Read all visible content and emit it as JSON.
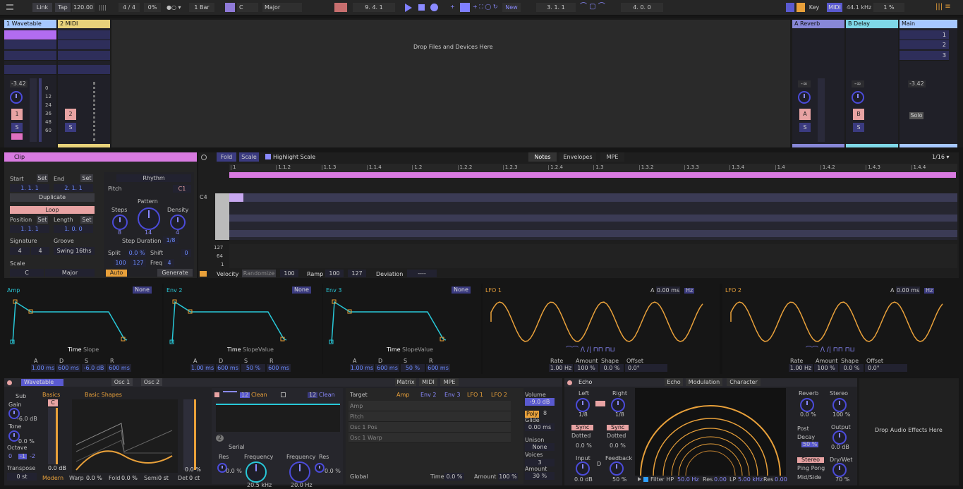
{
  "top": {
    "link": "Link",
    "tap": "Tap",
    "bpm": "120.00",
    "sig": "4 / 4",
    "swing": "0%",
    "quant": "1 Bar",
    "key": "C",
    "scale": "Major",
    "pos": "9.   4.   1",
    "new": "New",
    "loop_start": "3.   1.   1",
    "loop_len": "4.   0.   0",
    "key_btn": "Key",
    "midi_btn": "MIDI",
    "sr": "44.1 kHz",
    "cpu": "1 %"
  },
  "session": {
    "tracks": [
      {
        "name": "1 Wavetable",
        "color": "#a6c8ff",
        "vol": "-3.42",
        "num": "1",
        "solo": "S"
      },
      {
        "name": "2 MIDI",
        "color": "#e8d27a",
        "num": "2",
        "solo": "S"
      }
    ],
    "drop_text": "Drop Files and Devices Here",
    "returns": [
      {
        "name": "A Reverb",
        "vol": "-∞",
        "num": "A",
        "solo": "S"
      },
      {
        "name": "B Delay",
        "vol": "-∞",
        "num": "B",
        "solo": "S"
      }
    ],
    "main": {
      "name": "Main",
      "vol": "-3.42",
      "solo": "Solo",
      "scenes": [
        "1",
        "2",
        "3"
      ]
    },
    "db_ticks": [
      "0",
      "12",
      "24",
      "36",
      "48",
      "60"
    ]
  },
  "clip": {
    "title": "Clip",
    "start": "Start",
    "end": "End",
    "set": "Set",
    "start_val": "1.   1.   1",
    "end_val": "2.   1.   1",
    "duplicate": "Duplicate",
    "loop": "Loop",
    "position": "Position",
    "length": "Length",
    "pos_val": "1.   1.   1",
    "len_val": "1.   0.   0",
    "signature": "Signature",
    "groove": "Groove",
    "sig_num": "4",
    "sig_den": "4",
    "groove_val": "Swing 16ths",
    "scale": "Scale",
    "scale_key": "C",
    "scale_mode": "Major"
  },
  "rhythm": {
    "title": "Rhythm",
    "pitch": "Pitch",
    "pitch_val": "C1",
    "steps": "Steps",
    "pattern": "Pattern",
    "density": "Density",
    "steps_val": "8",
    "pattern_val": "14",
    "density_val": "4",
    "step_dur": "Step Duration",
    "step_dur_val": "1/8",
    "split": "Split",
    "split_val": "0.0 %",
    "shift": "Shift",
    "shift_val": "0",
    "vel1": "100",
    "vel2": "127",
    "freq": "Freq",
    "freq_val": "4",
    "auto": "Auto",
    "generate": "Generate"
  },
  "editor": {
    "fold": "Fold",
    "scale": "Scale",
    "highlight": "Highlight Scale",
    "tabs": [
      "Notes",
      "Envelopes",
      "MPE"
    ],
    "grid": "1/16 ▾",
    "ruler": [
      "1",
      "1.1.2",
      "1.1.3",
      "1.1.4",
      "1.2",
      "1.2.2",
      "1.2.3",
      "1.2.4",
      "1.3",
      "1.3.2",
      "1.3.3",
      "1.3.4",
      "1.4",
      "1.4.2",
      "1.4.3",
      "1.4.4"
    ],
    "c4": "C4",
    "vel_ticks": [
      "127",
      "64",
      "1"
    ],
    "velocity": "Velocity",
    "randomize": "Randomize",
    "vel_val": "100",
    "ramp": "Ramp",
    "ramp1": "100",
    "ramp2": "127",
    "deviation": "Deviation",
    "dev_val": "----"
  },
  "mod": {
    "envs": [
      {
        "name": "Amp",
        "target": "None",
        "time": "Time",
        "slope": "Slope",
        "value": "",
        "a": "1.00 ms",
        "d": "600 ms",
        "s": "-6.0 dB",
        "r": "600 ms"
      },
      {
        "name": "Env 2",
        "target": "None",
        "time": "Time",
        "slope": "Slope",
        "value": "Value",
        "a": "1.00 ms",
        "d": "600 ms",
        "s": "50 %",
        "r": "600 ms"
      },
      {
        "name": "Env 3",
        "target": "None",
        "time": "Time",
        "slope": "Slope",
        "value": "Value",
        "a": "1.00 ms",
        "d": "600 ms",
        "s": "50 %",
        "r": "600 ms"
      }
    ],
    "adsr": [
      "A",
      "D",
      "S",
      "R"
    ],
    "lfos": [
      {
        "name": "LFO 1",
        "a_label": "A",
        "a_val": "0.00 ms",
        "hz": "Hz",
        "rate": "Rate",
        "amount": "Amount",
        "shape": "Shape",
        "offset": "Offset",
        "rate_v": "1.00 Hz",
        "amount_v": "100 %",
        "shape_v": "0.0 %",
        "offset_v": "0.0°"
      },
      {
        "name": "LFO 2",
        "a_label": "A",
        "a_val": "0.00 ms",
        "hz": "Hz",
        "rate": "Rate",
        "amount": "Amount",
        "shape": "Shape",
        "offset": "Offset",
        "rate_v": "1.00 Hz",
        "amount_v": "100 %",
        "shape_v": "0.0 %",
        "offset_v": "0.0°"
      }
    ]
  },
  "wt": {
    "title": "Wavetable",
    "osc1": "Osc 1",
    "osc2": "Osc 2",
    "sub": "Sub",
    "gain": "Gain",
    "gain_v": "-6.0 dB",
    "tone": "Tone",
    "tone_v": "0.0 %",
    "octave": "Octave",
    "oct_vals": [
      "0",
      "-1",
      "-2"
    ],
    "transpose": "Transpose",
    "trans_v": "0 st",
    "basics": "Basics",
    "shapes": "Basic Shapes",
    "c_lbl": "C",
    "db0": "0.0 dB",
    "modern": "Modern",
    "warp": "Warp",
    "warp_v": "0.0 %",
    "fold": "Fold",
    "fold_v": "0.0 %",
    "semi": "Semi",
    "semi_v": "0 st",
    "det": "Det",
    "det_v": "0 ct",
    "pct": "0.0 %",
    "f1_12": "12",
    "f1_clean": "Clean",
    "f2_12": "12",
    "f2_clean": "Clean",
    "serial": "Serial",
    "res": "Res",
    "res_v": "0.0 %",
    "freq": "Frequency",
    "freq1": "20.5 kHz",
    "freq2": "20.0 Hz",
    "res2_v": "0.0 %",
    "num2": "2",
    "mtabs": [
      "Matrix",
      "MIDI",
      "MPE"
    ],
    "target": "Target",
    "cols": [
      "Amp",
      "Env 2",
      "Env 3",
      "LFO 1",
      "LFO 2"
    ],
    "rows": [
      "Amp",
      "Pitch",
      "Osc 1 Pos",
      "Osc 1 Warp"
    ],
    "global": "Global",
    "time": "Time",
    "time_v": "0.0 %",
    "amount": "Amount",
    "amount_v": "100 %",
    "volume": "Volume",
    "vol_v": "-9.0 dB",
    "poly": "Poly",
    "poly_n": "8",
    "glide": "Glide",
    "glide_v": "0.00 ms",
    "unison": "Unison",
    "unison_v": "None",
    "voices": "Voices",
    "voices_v": "3",
    "amt": "Amount",
    "amt_v": "30 %"
  },
  "echo": {
    "title": "Echo",
    "tabs": [
      "Echo",
      "Modulation",
      "Character"
    ],
    "left": "Left",
    "right": "Right",
    "l_v": "1/8",
    "r_v": "1/8",
    "sync": "Sync",
    "dotted": "Dotted",
    "pct": "0.0 %",
    "input": "Input",
    "input_v": "0.0 dB",
    "feedback": "Feedback",
    "fb_v": "50 %",
    "d": "D",
    "filter": "Filter HP",
    "hp_v": "50.0 Hz",
    "res": "Res",
    "res_v": "0.00",
    "lp": "LP",
    "lp_v": "5.00 kHz",
    "res2_v": "0.00",
    "reverb": "Reverb",
    "rev_v": "0.0 %",
    "stereo": "Stereo",
    "st_v": "100 %",
    "post": "Post",
    "decay": "Decay",
    "decay_v": "50 %",
    "output": "Output",
    "out_v": "0.0 dB",
    "stereo_btn": "Stereo",
    "pingpong": "Ping Pong",
    "midside": "Mid/Side",
    "drywet": "Dry/Wet",
    "dw_v": "70 %"
  },
  "drop_fx": "Drop Audio Effects Here"
}
